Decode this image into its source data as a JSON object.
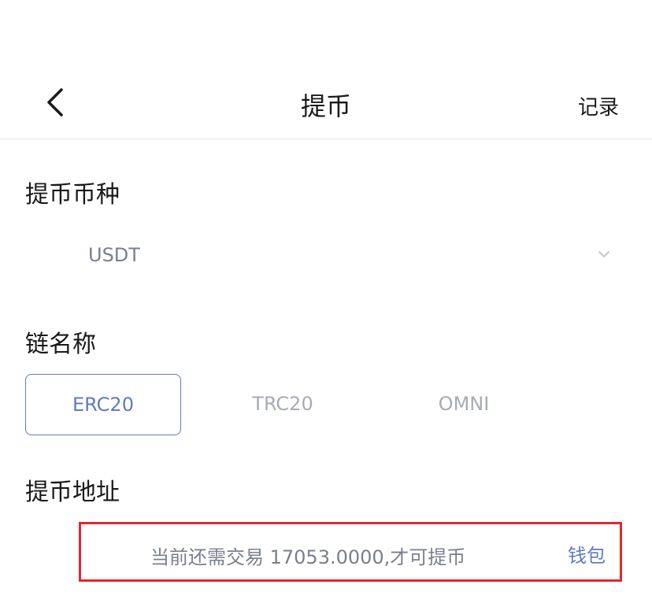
{
  "header": {
    "title": "提币",
    "record_label": "记录",
    "back_icon": "chevron-left-icon"
  },
  "coin_section": {
    "label": "提币币种",
    "selected": "USDT",
    "dropdown_icon": "chevron-down-icon"
  },
  "chain_section": {
    "label": "链名称",
    "options": [
      {
        "label": "ERC20",
        "active": true
      },
      {
        "label": "TRC20",
        "active": false
      },
      {
        "label": "OMNI",
        "active": false
      }
    ]
  },
  "address_section": {
    "label": "提币地址",
    "placeholder": "",
    "toast": "当前还需交易 17053.0000,才可提币",
    "wallet_label": "钱包"
  },
  "colors": {
    "accent": "#5f7cc0",
    "highlight_border": "#e3262d",
    "muted_text": "#7a7f8c"
  }
}
